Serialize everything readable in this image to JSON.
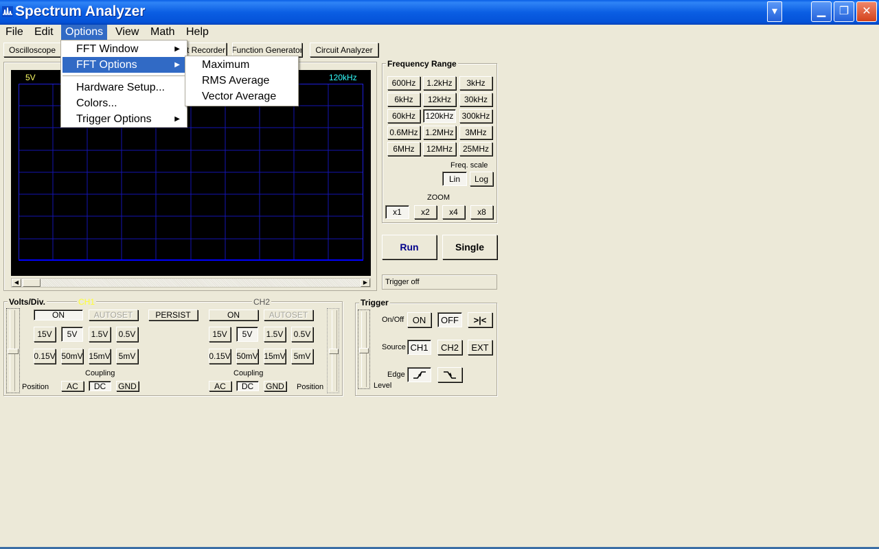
{
  "window": {
    "title": "Spectrum Analyzer"
  },
  "menu": [
    "File",
    "Edit",
    "Options",
    "View",
    "Math",
    "Help"
  ],
  "toolbar": {
    "oscilloscope": "Oscilloscope",
    "recorder": "t Recorder",
    "function_generator": "Function Generator",
    "circuit_analyzer": "Circuit Analyzer"
  },
  "options_menu": {
    "fft_window": "FFT Window",
    "fft_options": "FFT Options",
    "hardware_setup": "Hardware Setup...",
    "colors": "Colors...",
    "trigger_options": "Trigger Options"
  },
  "fft_options_submenu": [
    "Maximum",
    "RMS Average",
    "Vector Average"
  ],
  "display": {
    "volts_label": "5V",
    "freq_label": "120kHz",
    "grid_color": "#1a1ad0",
    "trace_color": "#0000ff",
    "volts_color": "#ffff66",
    "freq_color": "#33ffff"
  },
  "frequency_range": {
    "title": "Frequency Range",
    "buttons": [
      "600Hz",
      "1.2kHz",
      "3kHz",
      "6kHz",
      "12kHz",
      "30kHz",
      "60kHz",
      "120kHz",
      "300kHz",
      "0.6MHz",
      "1.2MHz",
      "3MHz",
      "6MHz",
      "12MHz",
      "25MHz"
    ],
    "selected": "120kHz",
    "freq_scale_label": "Freq. scale",
    "scale_lin": "Lin",
    "scale_log": "Log",
    "zoom_label": "ZOOM",
    "zoom": [
      "x1",
      "x2",
      "x4",
      "x8"
    ]
  },
  "run": {
    "run_label": "Run",
    "single_label": "Single",
    "status": "Trigger off"
  },
  "volts_div": {
    "title": "Volts/Div.",
    "ch1": "CH1",
    "ch2": "CH2",
    "on": "ON",
    "autoset": "AUTOSET",
    "persist": "PERSIST",
    "volts": [
      "15V",
      "5V",
      "1.5V",
      "0.5V",
      "0.15V",
      "50mV",
      "15mV",
      "5mV"
    ],
    "coupling": "Coupling",
    "ac": "AC",
    "dc": "DC",
    "gnd": "GND",
    "position": "Position"
  },
  "trigger": {
    "title": "Trigger",
    "onoff_label": "On/Off",
    "on": "ON",
    "off": "OFF",
    "center": ">|<",
    "source_label": "Source",
    "ch1": "CH1",
    "ch2": "CH2",
    "ext": "EXT",
    "edge_label": "Edge",
    "level_label": "Level"
  }
}
